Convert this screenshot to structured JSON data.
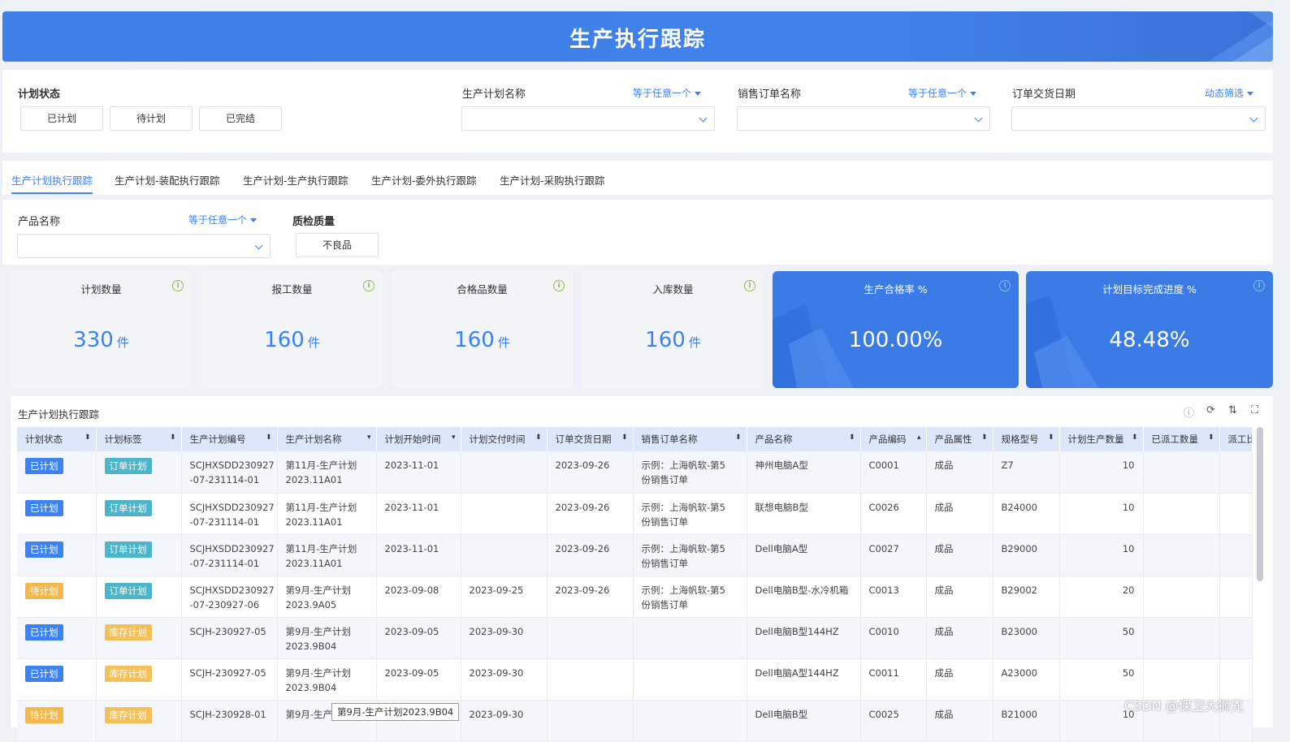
{
  "header": {
    "title": "生产执行跟踪"
  },
  "filters": {
    "status_label": "计划状态",
    "status_options": [
      "已计划",
      "待计划",
      "已完结"
    ],
    "plan_name_label": "生产计划名称",
    "plan_name_op": "等于任意一个",
    "sales_order_label": "销售订单名称",
    "sales_order_op": "等于任意一个",
    "delivery_label": "订单交货日期",
    "delivery_op": "动态筛选"
  },
  "tabs": [
    "生产计划执行跟踪",
    "生产计划-装配执行跟踪",
    "生产计划-生产执行跟踪",
    "生产计划-委外执行跟踪",
    "生产计划-采购执行跟踪"
  ],
  "subfilters": {
    "product_label": "产品名称",
    "product_op": "等于任意一个",
    "quality_label": "质检质量",
    "quality_option": "不良品"
  },
  "kpis": [
    {
      "title": "计划数量",
      "value": "330",
      "unit": "件"
    },
    {
      "title": "报工数量",
      "value": "160",
      "unit": "件"
    },
    {
      "title": "合格品数量",
      "value": "160",
      "unit": "件"
    },
    {
      "title": "入库数量",
      "value": "160",
      "unit": "件"
    },
    {
      "title": "生产合格率 %",
      "value": "100.00%"
    },
    {
      "title": "计划目标完成进度 %",
      "value": "48.48%"
    }
  ],
  "table": {
    "title": "生产计划执行跟踪",
    "columns": [
      "计划状态",
      "计划标签",
      "生产计划编号",
      "生产计划名称",
      "计划开始时间",
      "计划交付时间",
      "订单交货日期",
      "销售订单名称",
      "产品名称",
      "产品编码",
      "产品属性",
      "规格型号",
      "计划生产数量",
      "已派工数量",
      "派工比"
    ],
    "rows": [
      {
        "status": "已计划",
        "tag": "订单计划",
        "code": [
          "SCJHXSDD230927",
          "-07-231114-01"
        ],
        "name": [
          "第11月-生产计划",
          "2023.11A01"
        ],
        "start": "2023-11-01",
        "deliver": "",
        "order_date": "2023-09-26",
        "order": [
          "示例：上海帆软-第5",
          "份销售订单"
        ],
        "product": "神州电脑A型",
        "pcode": "C0001",
        "attr": "成品",
        "spec": "Z7",
        "qty": "10"
      },
      {
        "status": "已计划",
        "tag": "订单计划",
        "code": [
          "SCJHXSDD230927",
          "-07-231114-01"
        ],
        "name": [
          "第11月-生产计划",
          "2023.11A01"
        ],
        "start": "2023-11-01",
        "deliver": "",
        "order_date": "2023-09-26",
        "order": [
          "示例：上海帆软-第5",
          "份销售订单"
        ],
        "product": "联想电脑B型",
        "pcode": "C0026",
        "attr": "成品",
        "spec": "B24000",
        "qty": "10"
      },
      {
        "status": "已计划",
        "tag": "订单计划",
        "code": [
          "SCJHXSDD230927",
          "-07-231114-01"
        ],
        "name": [
          "第11月-生产计划",
          "2023.11A01"
        ],
        "start": "2023-11-01",
        "deliver": "",
        "order_date": "2023-09-26",
        "order": [
          "示例：上海帆软-第5",
          "份销售订单"
        ],
        "product": "Dell电脑A型",
        "pcode": "C0027",
        "attr": "成品",
        "spec": "B29000",
        "qty": "10"
      },
      {
        "status": "待计划",
        "tag": "订单计划",
        "code": [
          "SCJHXSDD230927",
          "-07-230927-06"
        ],
        "name": [
          "第9月-生产计划",
          "2023.9A05"
        ],
        "start": "2023-09-08",
        "deliver": "2023-09-25",
        "order_date": "2023-09-26",
        "order": [
          "示例：上海帆软-第5",
          "份销售订单"
        ],
        "product": "Dell电脑B型-水冷机箱",
        "pcode": "C0013",
        "attr": "成品",
        "spec": "B29002",
        "qty": "20"
      },
      {
        "status": "已计划",
        "tag": "库存计划",
        "code": [
          "SCJH-230927-05",
          ""
        ],
        "name": [
          "第9月-生产计划",
          "2023.9B04"
        ],
        "start": "2023-09-05",
        "deliver": "2023-09-30",
        "order_date": "",
        "order": [
          "",
          ""
        ],
        "product": "Dell电脑B型144HZ",
        "pcode": "C0010",
        "attr": "成品",
        "spec": "B23000",
        "qty": "50"
      },
      {
        "status": "已计划",
        "tag": "库存计划",
        "code": [
          "SCJH-230927-05",
          ""
        ],
        "name": [
          "第9月-生产计划",
          "2023.9B04"
        ],
        "start": "2023-09-05",
        "deliver": "2023-09-30",
        "order_date": "",
        "order": [
          "",
          ""
        ],
        "product": "Dell电脑A型144HZ",
        "pcode": "C0011",
        "attr": "成品",
        "spec": "A23000",
        "qty": "50"
      },
      {
        "status": "待计划",
        "tag": "库存计划",
        "code": [
          "SCJH-230928-01",
          ""
        ],
        "name": [
          "第9月-生产",
          ""
        ],
        "start": "",
        "deliver": "2023-09-30",
        "order_date": "",
        "order": [
          "",
          ""
        ],
        "product": "Dell电脑B型",
        "pcode": "C0025",
        "attr": "成品",
        "spec": "B21000",
        "qty": "10"
      }
    ]
  },
  "tooltip": "第9月-生产计划2023.9B04",
  "watermark": "CSDN @保卫大狮兄",
  "colors": {
    "primary": "#3b82f6",
    "banner": "#4182ea",
    "planned": "#3b82f6",
    "pending": "#f6b84a",
    "order_tag": "#4cb5c9",
    "stock_tag": "#f4c05a"
  }
}
